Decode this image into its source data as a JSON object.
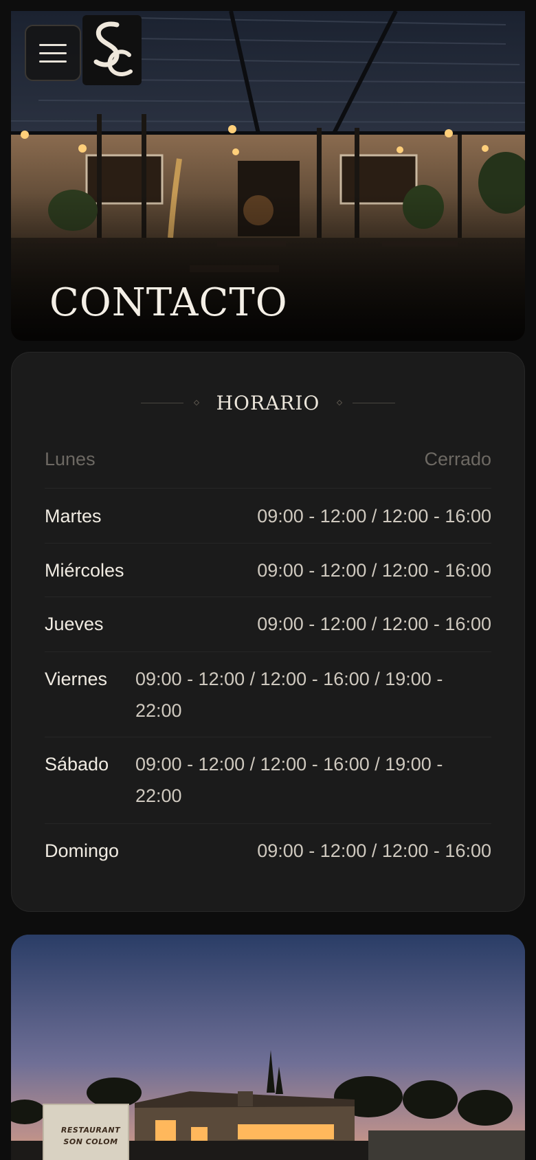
{
  "header": {
    "menu_label": "",
    "logo_text": "SC"
  },
  "hero": {
    "title": "CONTACTO"
  },
  "schedule": {
    "title": "HORARIO",
    "rows": [
      {
        "day": "Lunes",
        "hours": "Cerrado",
        "closed": true
      },
      {
        "day": "Martes",
        "hours": "09:00 - 12:00 / 12:00 - 16:00"
      },
      {
        "day": "Miércoles",
        "hours": "09:00 - 12:00 / 12:00 - 16:00"
      },
      {
        "day": "Jueves",
        "hours": "09:00 - 12:00 / 12:00 - 16:00"
      },
      {
        "day": "Viernes",
        "hours": "09:00 - 12:00 / 12:00 - 16:00 / 19:00 - 22:00"
      },
      {
        "day": "Sábado",
        "hours": "09:00 - 12:00 / 12:00 - 16:00 / 19:00 - 22:00"
      },
      {
        "day": "Domingo",
        "hours": "09:00 - 12:00 / 12:00 - 16:00"
      }
    ]
  },
  "photo": {
    "sign_line1": "RESTAURANT",
    "sign_line2": "SON COLOM"
  },
  "colors": {
    "background": "#0d0d0d",
    "card": "#1b1b1b",
    "text": "#f2ede4",
    "muted": "#6d6963"
  }
}
